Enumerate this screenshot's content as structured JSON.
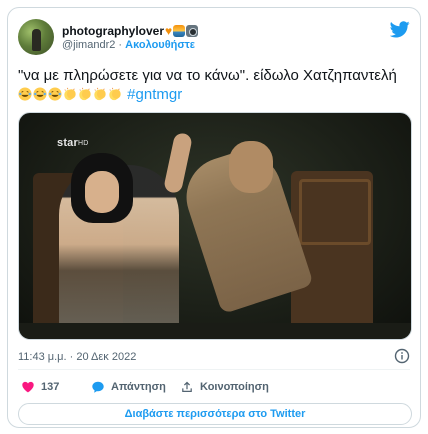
{
  "user": {
    "display_name": "photographylover",
    "handle": "@jimandr2",
    "separator": "·",
    "follow_label": "Ακολουθήστε",
    "badges": [
      "orange-heart",
      "sunset",
      "camera"
    ]
  },
  "tweet": {
    "text_main": "\"να με πληρώσετε για να το κάνω\". είδωλο Χατζηπαντελή",
    "emojis": [
      "joy",
      "joy",
      "joy",
      "clap",
      "clap",
      "clap",
      "clap"
    ],
    "hashtag": "#gntmgr"
  },
  "media": {
    "channel_logo": "star",
    "channel_logo_suffix": "HD"
  },
  "meta": {
    "time": "11:43 μ.μ.",
    "separator": "·",
    "date": "20 Δεκ 2022"
  },
  "actions": {
    "like_count": "137",
    "reply_label": "Απάντηση",
    "share_label": "Κοινοποίηση"
  },
  "footer": {
    "read_more_label": "Διαβάστε περισσότερα στο Twitter"
  },
  "colors": {
    "accent": "#1d9bf0",
    "like": "#f91880",
    "muted": "#536471",
    "border": "#cfd9de"
  }
}
